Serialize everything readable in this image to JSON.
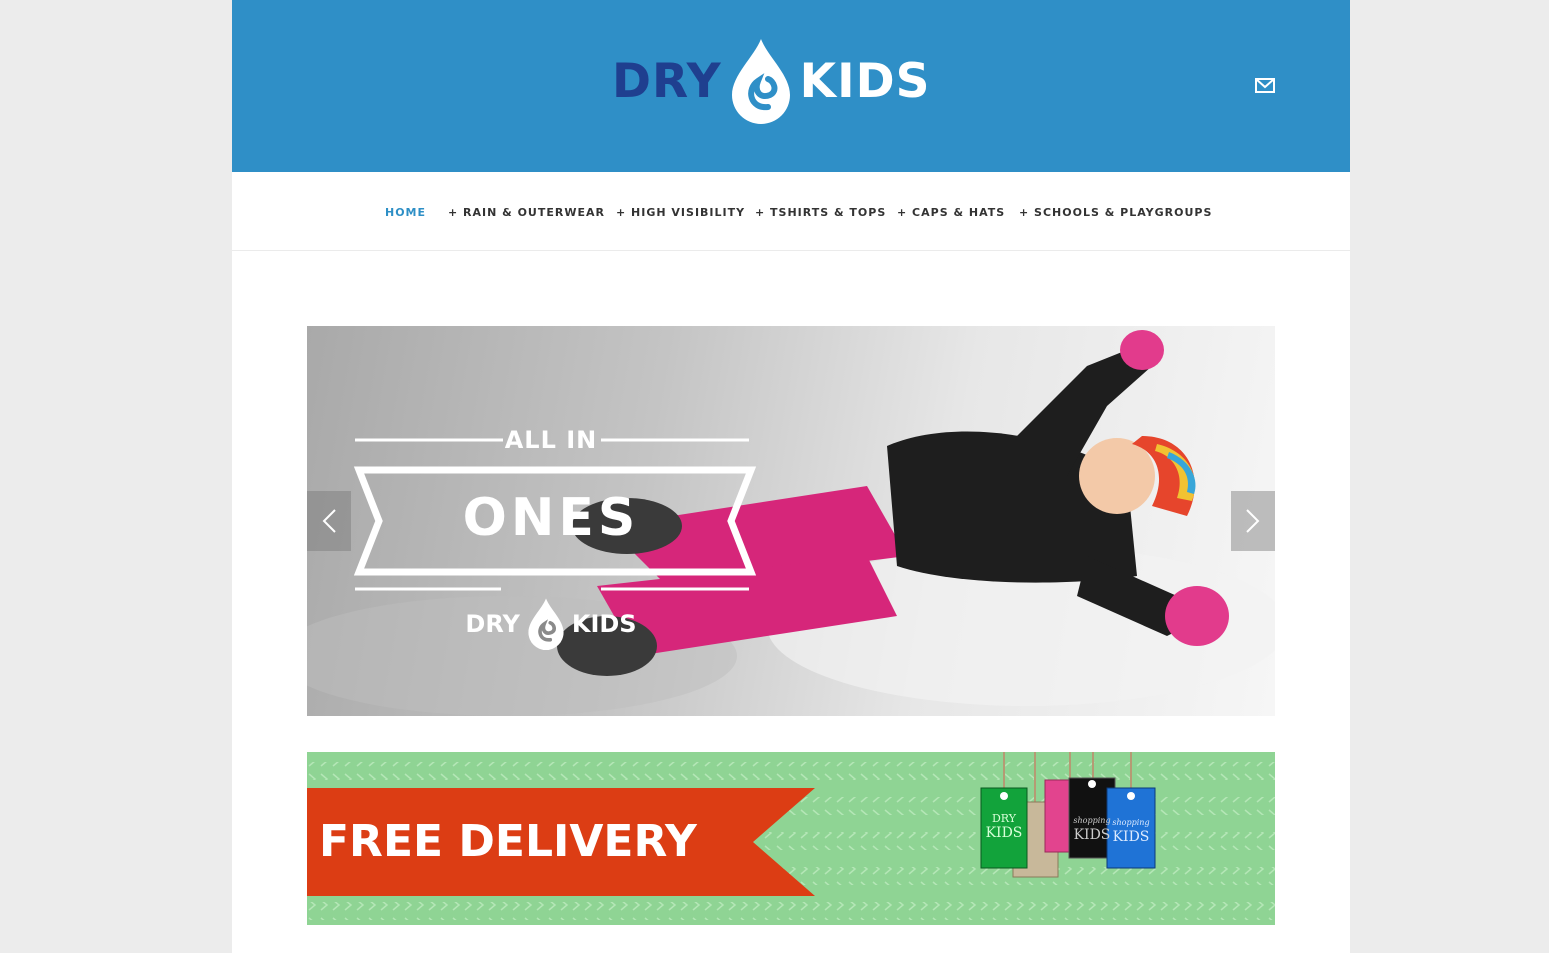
{
  "header": {
    "logo_left": "DRY",
    "logo_right": "KIDS",
    "contact_icon": "mail-icon",
    "brand_color": "#2f8fc7"
  },
  "nav": {
    "items": [
      {
        "label": "HOME",
        "active": true
      },
      {
        "label": "+ RAIN & OUTERWEAR",
        "active": false
      },
      {
        "label": "+ HIGH VISIBILITY",
        "active": false
      },
      {
        "label": "+ TSHIRTS & TOPS",
        "active": false
      },
      {
        "label": "+ CAPS & HATS",
        "active": false
      },
      {
        "label": "+ SCHOOLS & PLAYGROUPS",
        "active": false
      }
    ],
    "active_color": "#2e8fc6"
  },
  "slider": {
    "line1": "ALL IN",
    "line2": "ONES",
    "brand_left": "DRY",
    "brand_right": "KIDS",
    "prev_icon": "chevron-left-icon",
    "next_icon": "chevron-right-icon"
  },
  "promo": {
    "text": "FREE DELIVERY",
    "ribbon_color": "#dc3d14",
    "tag_texts": [
      "DRY",
      "KIDS",
      "shopping",
      "KIDS",
      "shopping",
      "KIDS"
    ]
  }
}
